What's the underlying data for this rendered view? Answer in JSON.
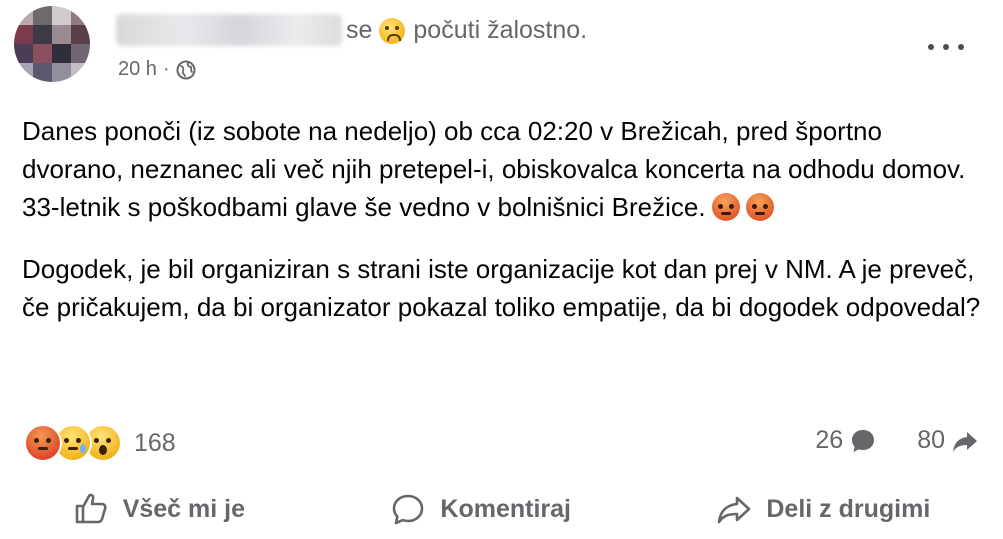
{
  "post": {
    "feeling_prefix": "se",
    "feeling_text": "počuti žalostno.",
    "time": "20 h",
    "separator": "·",
    "paragraphs": [
      "Danes ponoči (iz sobote na nedeljo) ob cca  02:20 v Brežicah, pred športno dvorano, neznanec ali več njih pretepel-i, obiskovalca koncerta na odhodu domov. 33-letnik s poškodbami glave še vedno v bolnišnici Brežice.",
      "Dogodek, je bil organiziran s strani iste organizacije kot dan prej v NM. A je preveč, če pričakujem, da bi organizator pokazal toliko empatije, da bi dogodek odpovedal?"
    ],
    "inline_emojis": [
      "angry-emoji",
      "angry-emoji"
    ]
  },
  "stats": {
    "reaction_icons": [
      "angry-reaction",
      "sad-reaction",
      "wow-reaction"
    ],
    "reaction_count": "168",
    "comment_count": "26",
    "share_count": "80"
  },
  "actions": {
    "like_label": "Všeč mi je",
    "comment_label": "Komentiraj",
    "share_label": "Deli z drugimi"
  },
  "colors": {
    "secondary_text": "#65676b",
    "primary_text": "#050505",
    "icon_gray": "#65676b"
  }
}
